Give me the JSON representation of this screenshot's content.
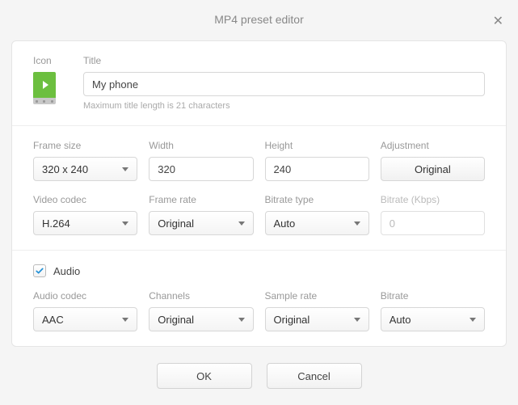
{
  "header": {
    "title": "MP4 preset editor"
  },
  "icon_section": {
    "label": "Icon"
  },
  "title_section": {
    "label": "Title",
    "value": "My phone",
    "hint": "Maximum title length is 21 characters"
  },
  "video": {
    "frame_size": {
      "label": "Frame size",
      "value": "320 x 240"
    },
    "width": {
      "label": "Width",
      "value": "320"
    },
    "height": {
      "label": "Height",
      "value": "240"
    },
    "adjustment": {
      "label": "Adjustment",
      "value": "Original"
    },
    "video_codec": {
      "label": "Video codec",
      "value": "H.264"
    },
    "frame_rate": {
      "label": "Frame rate",
      "value": "Original"
    },
    "bitrate_type": {
      "label": "Bitrate type",
      "value": "Auto"
    },
    "bitrate": {
      "label": "Bitrate (Kbps)",
      "value": "0"
    }
  },
  "audio_toggle": {
    "label": "Audio",
    "checked": true
  },
  "audio": {
    "audio_codec": {
      "label": "Audio codec",
      "value": "AAC"
    },
    "channels": {
      "label": "Channels",
      "value": "Original"
    },
    "sample_rate": {
      "label": "Sample rate",
      "value": "Original"
    },
    "bitrate": {
      "label": "Bitrate",
      "value": "Auto"
    }
  },
  "buttons": {
    "ok": "OK",
    "cancel": "Cancel"
  }
}
